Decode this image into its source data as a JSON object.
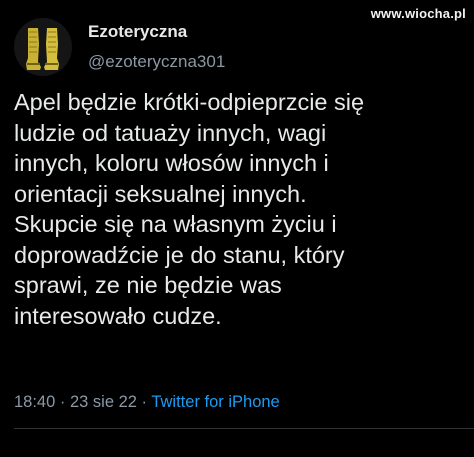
{
  "watermark": "www.wiocha.pl",
  "tweet": {
    "display_name": "Ezoteryczna",
    "handle": "@ezoteryczna301",
    "avatar_icon": "golden-boots-icon",
    "text_lines": [
      "Apel będzie krótki-odpieprzcie się",
      "ludzie od tatuaży innych, wagi",
      "innych, koloru włosów innych i",
      "orientacji seksualnej innych.",
      "Skupcie się na własnym życiu i",
      "doprowadźcie je do stanu, który",
      "sprawi, ze nie będzie was",
      "interesowało cudze."
    ],
    "time": "18:40",
    "separator": "·",
    "date": "23 sie 22",
    "source": "Twitter for iPhone"
  },
  "colors": {
    "background": "#000000",
    "text": "#e7e9ea",
    "secondary": "#8b98a5",
    "link": "#1d9bf0",
    "boots": "#c9b233"
  }
}
